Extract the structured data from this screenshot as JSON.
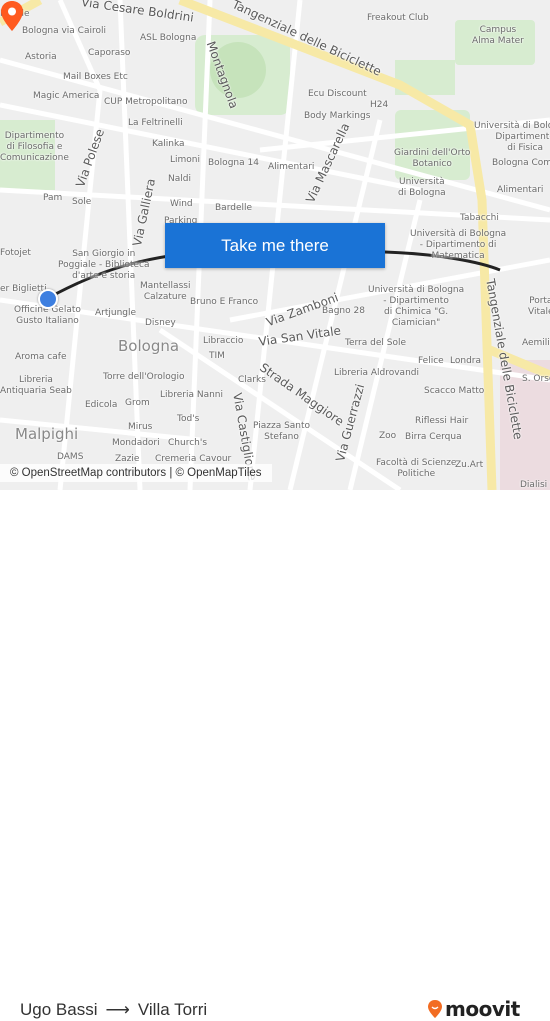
{
  "map": {
    "labels": [
      "Mobile",
      "Via Cesare Boldrini",
      "Tangenziale delle Biciclette",
      "Freakout Club",
      "Campus\nAlma Mater",
      "Bologna via Cairoli",
      "ASL Bologna",
      "Caporaso",
      "Astoria",
      "Montagnola",
      "Mail Boxes Etc",
      "Magic America",
      "CUP Metropolitano",
      "Ecu Discount",
      "H24",
      "Body Markings",
      "La Feltrinelli",
      "Università di Bologna -\nDipartimento\ndi Fisica",
      "Dipartimento\ndi Filosofia e\nComunicazione",
      "Via Polese",
      "Kalinka",
      "Giardini dell'Orto\nBotanico",
      "Limoni",
      "Bologna 14",
      "Alimentari",
      "Via Mascarella",
      "Bologna Comp",
      "Naldi",
      "Università\ndi Bologna",
      "Alimentari",
      "Pam",
      "Sole",
      "Via Galliera",
      "Wind",
      "Bardelle",
      "Parking",
      "Tabacchi",
      "Università di Bologna\n- Dipartimento di\nMatematica",
      "Fotojet",
      "San Giorgio in\nPoggiale - Biblioteca\nd'arte e storia",
      "er Biglietti",
      "Mantellassi\nCalzature",
      "Officine Gelato\nGusto Italiano",
      "Artjungle",
      "Bruno E Franco",
      "Via Zamboni",
      "Università di Bologna\n- Dipartimento\ndi Chimica \"G.\nCiamician\"",
      "Porta\nVitale",
      "Disney",
      "Bagno 28",
      "Bologna",
      "Libraccio",
      "Via San Vitale",
      "Terra del Sole",
      "Aemilia",
      "Aroma cafe",
      "TIM",
      "Felice",
      "Londra",
      "Tangenziale delle Biciclette",
      "Strada Maggiore",
      "Libreria Aldrovandi",
      "S. Orso",
      "Libreria\nAntiquaria Seab",
      "Torre dell'Orologio",
      "Clarks",
      "Scacco Matto",
      "Libreria Nanni",
      "Edicola",
      "Grom",
      "Via Castiglione",
      "Tod's",
      "Riflessi Hair",
      "Malpighi",
      "Mirus",
      "Piazza Santo\nStefano",
      "Via Guerrazzi",
      "Birra Cerqua",
      "Zoo",
      "Mondadori",
      "Church's",
      "DAMS",
      "Zazie",
      "Cremeria Cavour",
      "Facoltà di Scienze\nPolitiche",
      "Zu.Art",
      "Dialisi S"
    ],
    "cta_label": "Take me there",
    "attribution": "© OpenStreetMap contributors | © OpenMapTiles",
    "colors": {
      "route": "#222222",
      "origin": "#3d7fe0",
      "destination": "#ff5a1f",
      "button": "#1a73d6"
    }
  },
  "footer": {
    "origin": "Ugo Bassi",
    "arrow": "⟶",
    "destination": "Villa Torri",
    "brand": "moovit",
    "brand_color": "#f26c22"
  }
}
